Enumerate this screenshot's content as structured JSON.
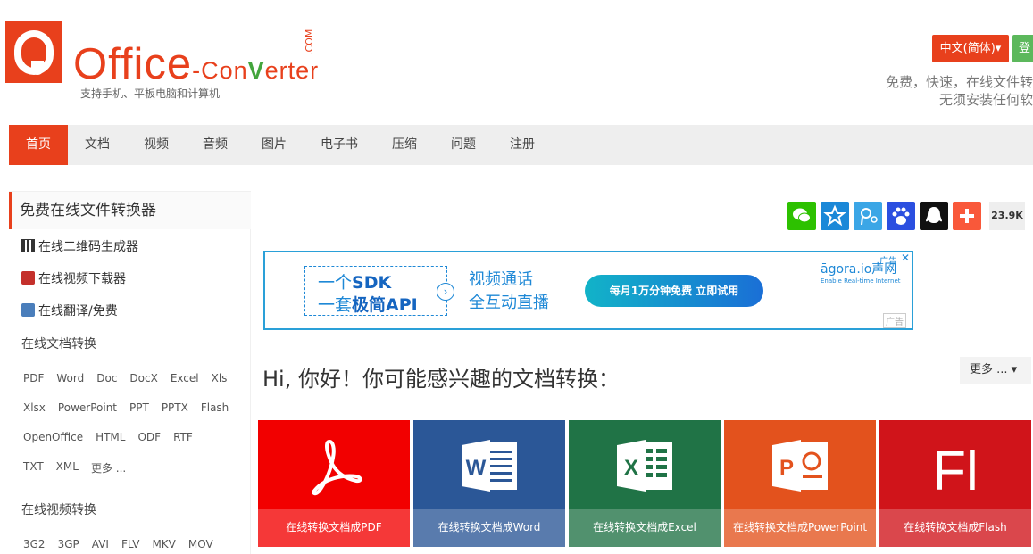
{
  "header": {
    "logo_office": "Office",
    "logo_dash": "-",
    "logo_con": "Con",
    "logo_v": "V",
    "logo_erter": "erter",
    "logo_com": ".COM",
    "logo_subtitle": "支持手机、平板电脑和计算机",
    "lang_label": "中文(简体)▾",
    "login_label": "登",
    "tagline_1": "免费，快速，在线文件转",
    "tagline_2": "无须安装任何软"
  },
  "nav": {
    "items": [
      "首页",
      "文档",
      "视频",
      "音频",
      "图片",
      "电子书",
      "压缩",
      "问题",
      "注册"
    ]
  },
  "sidebar": {
    "title": "免费在线文件转换器",
    "tools": [
      "在线二维码生成器",
      "在线视频下载器",
      "在线翻译/免费"
    ],
    "doc_section": "在线文档转换",
    "doc_rows": [
      [
        "PDF",
        "Word",
        "Doc",
        "DocX",
        "Excel",
        "Xls"
      ],
      [
        "Xlsx",
        "PowerPoint",
        "PPT",
        "PPTX",
        "Flash"
      ],
      [
        "OpenOffice",
        "HTML",
        "ODF",
        "RTF"
      ],
      [
        "TXT",
        "XML",
        "更多 ..."
      ]
    ],
    "video_section": "在线视频转换",
    "video_row": [
      "3G2",
      "3GP",
      "AVI",
      "FLV",
      "MKV",
      "MOV"
    ]
  },
  "share": {
    "count": "23.9K",
    "colors": {
      "wechat": "#2dc100",
      "qzone": "#1a88d8",
      "weibo": "#3ba6e6",
      "baidu": "#2b4fe0",
      "qq": "#111111",
      "more": "#f9583a"
    }
  },
  "ad": {
    "line1_a": "一个",
    "line1_b": "SDK",
    "line2_a": "一套",
    "line2_b": "极简API",
    "arrow": "›",
    "mid_1": "视频通话",
    "mid_2": "全互动直播",
    "cta": "每月1万分钟免费  立即试用",
    "brand": "āgora.io声网",
    "brand_sub": "Enable Real-time Internet",
    "tag": "广告",
    "close": "✕",
    "tag2": "广告"
  },
  "main": {
    "greeting": "Hi, 你好！你可能感兴趣的文档转换：",
    "more_label": "更多 ... ▾",
    "tiles": [
      {
        "caption": "在线转换文档成PDF",
        "color": "#f20000",
        "icon": "pdf-icon"
      },
      {
        "caption": "在线转换文档成Word",
        "color": "#2b5797",
        "icon": "word-icon"
      },
      {
        "caption": "在线转换文档成Excel",
        "color": "#207346",
        "icon": "excel-icon"
      },
      {
        "caption": "在线转换文档成PowerPoint",
        "color": "#e3521d",
        "icon": "powerpoint-icon"
      },
      {
        "caption": "在线转换文档成Flash",
        "color": "#d0141a",
        "icon": "flash-icon"
      }
    ]
  }
}
